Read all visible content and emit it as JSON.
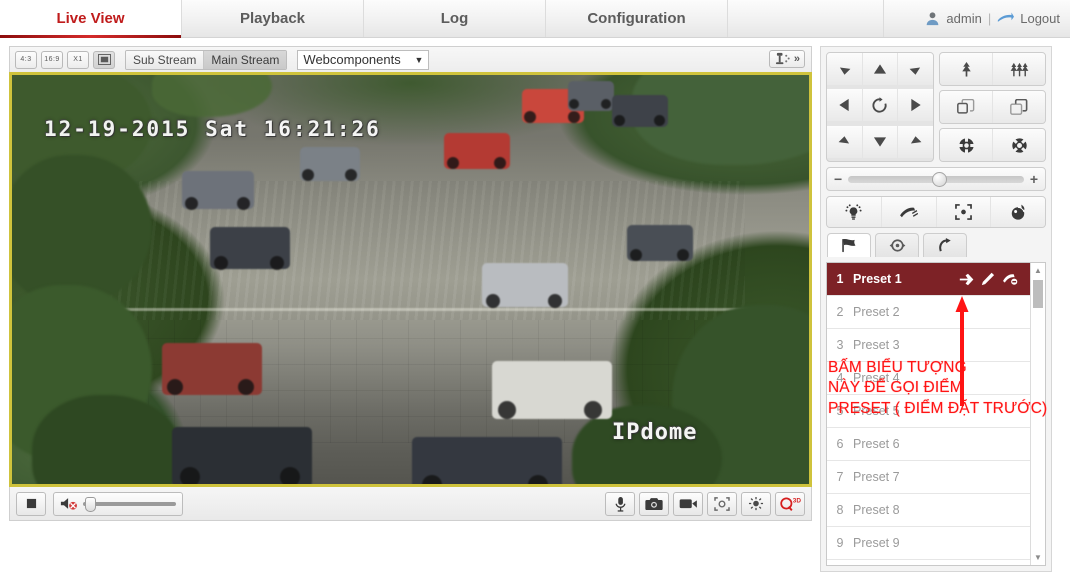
{
  "nav": {
    "tabs": [
      {
        "label": "Live View",
        "active": true
      },
      {
        "label": "Playback",
        "active": false
      },
      {
        "label": "Log",
        "active": false
      },
      {
        "label": "Configuration",
        "active": false
      }
    ],
    "user": "admin",
    "separator": "|",
    "logout": "Logout",
    "user_icon": "user-avatar-icon",
    "logout_icon": "logout-arrow-icon",
    "active_tab_color": "#c01c1c"
  },
  "video_toolbar": {
    "aspect_buttons": [
      {
        "label": "4:3",
        "name": "aspect-4-3"
      },
      {
        "label": "16:9",
        "name": "aspect-16-9"
      },
      {
        "label": "X1",
        "name": "aspect-original"
      },
      {
        "label": "",
        "name": "aspect-fullwindow",
        "icon": "fit-window-icon",
        "selected": true
      }
    ],
    "streams": [
      {
        "label": "Sub Stream",
        "active": false
      },
      {
        "label": "Main Stream",
        "active": true
      }
    ],
    "plugin_select": {
      "value": "Webcomponents",
      "caret": "▼"
    },
    "right_tool": {
      "icon": "ptz-capture-icon",
      "chevron": "»"
    }
  },
  "video": {
    "osd_timestamp": "12-19-2015 Sat 16:21:26",
    "osd_camera_name": "IPdome",
    "border_color": "#cfc33c"
  },
  "video_bottom": {
    "stop_button": {
      "name": "stop-live-view-button",
      "icon": "stop-square-icon"
    },
    "volume": {
      "name": "volume-slider",
      "icon": "speaker-muted-icon",
      "value": 0
    },
    "right_buttons": [
      {
        "name": "two-way-audio-button",
        "icon": "microphone-icon"
      },
      {
        "name": "capture-snapshot-button",
        "icon": "camera-icon"
      },
      {
        "name": "start-record-button",
        "icon": "video-camera-icon"
      },
      {
        "name": "digital-zoom-button",
        "icon": "digital-zoom-icon"
      },
      {
        "name": "image-adjust-button",
        "icon": "brightness-sun-icon"
      },
      {
        "name": "zoom-3d-button",
        "icon": "q3d-zoom-icon",
        "label": "Q",
        "sup": "3D",
        "color": "#d61f1f"
      }
    ]
  },
  "ptz": {
    "dpad": [
      {
        "name": "ptz-up-left",
        "icon": "arrow-up-left-icon"
      },
      {
        "name": "ptz-up",
        "icon": "arrow-up-icon"
      },
      {
        "name": "ptz-up-right",
        "icon": "arrow-up-right-icon"
      },
      {
        "name": "ptz-left",
        "icon": "arrow-left-icon"
      },
      {
        "name": "ptz-auto-scan",
        "icon": "auto-scan-circle-icon"
      },
      {
        "name": "ptz-right",
        "icon": "arrow-right-icon"
      },
      {
        "name": "ptz-down-left",
        "icon": "arrow-down-left-icon"
      },
      {
        "name": "ptz-down",
        "icon": "arrow-down-icon"
      },
      {
        "name": "ptz-down-right",
        "icon": "arrow-down-right-icon"
      }
    ],
    "zoom_rows": [
      [
        {
          "name": "zoom-in-button",
          "icon": "zoom-in-tree-icon"
        },
        {
          "name": "zoom-out-button",
          "icon": "zoom-out-trees-icon"
        }
      ],
      [
        {
          "name": "focus-near-button",
          "icon": "focus-near-squares-icon"
        },
        {
          "name": "focus-far-button",
          "icon": "focus-far-squares-icon"
        }
      ],
      [
        {
          "name": "iris-close-button",
          "icon": "iris-minus-icon"
        },
        {
          "name": "iris-open-button",
          "icon": "iris-plus-icon"
        }
      ]
    ],
    "speed": {
      "name": "ptz-speed-slider",
      "minus": "−",
      "plus": "+",
      "value": 50
    },
    "aux_buttons": [
      {
        "name": "light-button",
        "icon": "light-bulb-icon"
      },
      {
        "name": "wiper-button",
        "icon": "wiper-icon"
      },
      {
        "name": "auxiliary-focus-button",
        "icon": "auxiliary-focus-icon"
      },
      {
        "name": "lens-initialization-button",
        "icon": "lens-init-icon"
      }
    ],
    "mode_tabs": [
      {
        "name": "tab-preset",
        "icon": "flag-icon",
        "active": true
      },
      {
        "name": "tab-patrol",
        "icon": "patrol-cycle-icon",
        "active": false
      },
      {
        "name": "tab-pattern",
        "icon": "pattern-curve-icon",
        "active": false
      }
    ]
  },
  "presets": {
    "selected_index": 0,
    "row_icons": [
      {
        "name": "call-preset-icon",
        "title": "call"
      },
      {
        "name": "set-preset-icon",
        "title": "set"
      },
      {
        "name": "clear-preset-icon",
        "title": "clear"
      }
    ],
    "items": [
      {
        "num": "1",
        "label": "Preset 1"
      },
      {
        "num": "2",
        "label": "Preset 2"
      },
      {
        "num": "3",
        "label": "Preset 3"
      },
      {
        "num": "4",
        "label": "Preset 4"
      },
      {
        "num": "5",
        "label": "Preset 5"
      },
      {
        "num": "6",
        "label": "Preset 6"
      },
      {
        "num": "7",
        "label": "Preset 7"
      },
      {
        "num": "8",
        "label": "Preset 8"
      },
      {
        "num": "9",
        "label": "Preset 9"
      }
    ],
    "scrollbar": {
      "up": "▲",
      "down": "▼"
    }
  },
  "annotation": {
    "text": "BẤM BIỂU TƯỢNG\nNÀY ĐỂ GỌI ĐIỂM\nPRESET ( ĐIỂM ĐẶT TRƯỚC)",
    "color": "#ff1414",
    "arrow": "annotation-arrow-up"
  }
}
